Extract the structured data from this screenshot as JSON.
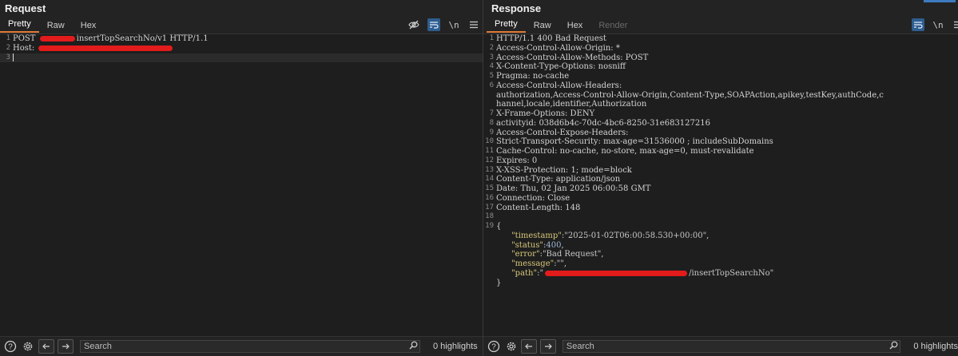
{
  "request": {
    "title": "Request",
    "tabs": [
      "Pretty",
      "Raw",
      "Hex"
    ],
    "toolbar": {
      "newline_toggle": "\\n"
    },
    "lines": [
      {
        "n": "1",
        "pre": "POST ",
        "post": "insertTopSearchNo/v1 HTTP/1.1"
      },
      {
        "n": "2",
        "pre": "Host: ",
        "post": ""
      },
      {
        "n": "3",
        "pre": "",
        "post": ""
      }
    ],
    "search_placeholder": "Search",
    "highlights": "0 highlights"
  },
  "response": {
    "title": "Response",
    "tabs": [
      "Pretty",
      "Raw",
      "Hex",
      "Render"
    ],
    "toolbar": {
      "newline_toggle": "\\n"
    },
    "header_lines": [
      {
        "n": "1",
        "text": "HTTP/1.1 400 Bad Request"
      },
      {
        "n": "2",
        "text": "Access-Control-Allow-Origin: *"
      },
      {
        "n": "3",
        "text": "Access-Control-Allow-Methods: POST"
      },
      {
        "n": "4",
        "text": "X-Content-Type-Options: nosniff"
      },
      {
        "n": "5",
        "text": "Pragma: no-cache"
      },
      {
        "n": "6",
        "text": "Access-Control-Allow-Headers:"
      },
      {
        "n": "",
        "text": "authorization,Access-Control-Allow-Origin,Content-Type,SOAPAction,apikey,testKey,authCode,c"
      },
      {
        "n": "",
        "text": "hannel,locale,identifier,Authorization"
      },
      {
        "n": "7",
        "text": "X-Frame-Options: DENY"
      },
      {
        "n": "8",
        "text": "activityid: 038d6b4c-70dc-4bc6-8250-31e683127216"
      },
      {
        "n": "9",
        "text": "Access-Control-Expose-Headers:"
      },
      {
        "n": "10",
        "text": "Strict-Transport-Security: max-age=31536000 ; includeSubDomains"
      },
      {
        "n": "11",
        "text": "Cache-Control: no-cache, no-store, max-age=0, must-revalidate"
      },
      {
        "n": "12",
        "text": "Expires: 0"
      },
      {
        "n": "13",
        "text": "X-XSS-Protection: 1; mode=block"
      },
      {
        "n": "14",
        "text": "Content-Type: application/json"
      },
      {
        "n": "15",
        "text": "Date: Thu, 02 Jan 2025 06:00:58 GMT"
      },
      {
        "n": "16",
        "text": "Connection: Close"
      },
      {
        "n": "17",
        "text": "Content-Length: 148"
      },
      {
        "n": "18",
        "text": ""
      },
      {
        "n": "19",
        "text": "{"
      }
    ],
    "json_body": {
      "timestamp_key": "\"timestamp\"",
      "timestamp_val": "\"2025-01-02T06:00:58.530+00:00\"",
      "status_key": "\"status\"",
      "status_val": "400",
      "error_key": "\"error\"",
      "error_val": "\"Bad Request\"",
      "message_key": "\"message\"",
      "message_val": "\"\"",
      "path_key": "\"path\"",
      "path_open": "\"",
      "path_tail": "/insertTopSearchNo\"",
      "close": "}"
    },
    "search_placeholder": "Search",
    "highlights": "0 highlights"
  },
  "colors": {
    "accent_tab": "#e07b39",
    "redaction": "#e21b1b",
    "json_key": "#d7c77a",
    "toolbar_active": "#2e5d8f"
  },
  "icons": [
    "eye-off-icon",
    "wrap-icon",
    "newline-icon",
    "menu-icon",
    "help-icon",
    "settings-icon",
    "back-arrow-icon",
    "forward-arrow-icon",
    "search-icon"
  ]
}
